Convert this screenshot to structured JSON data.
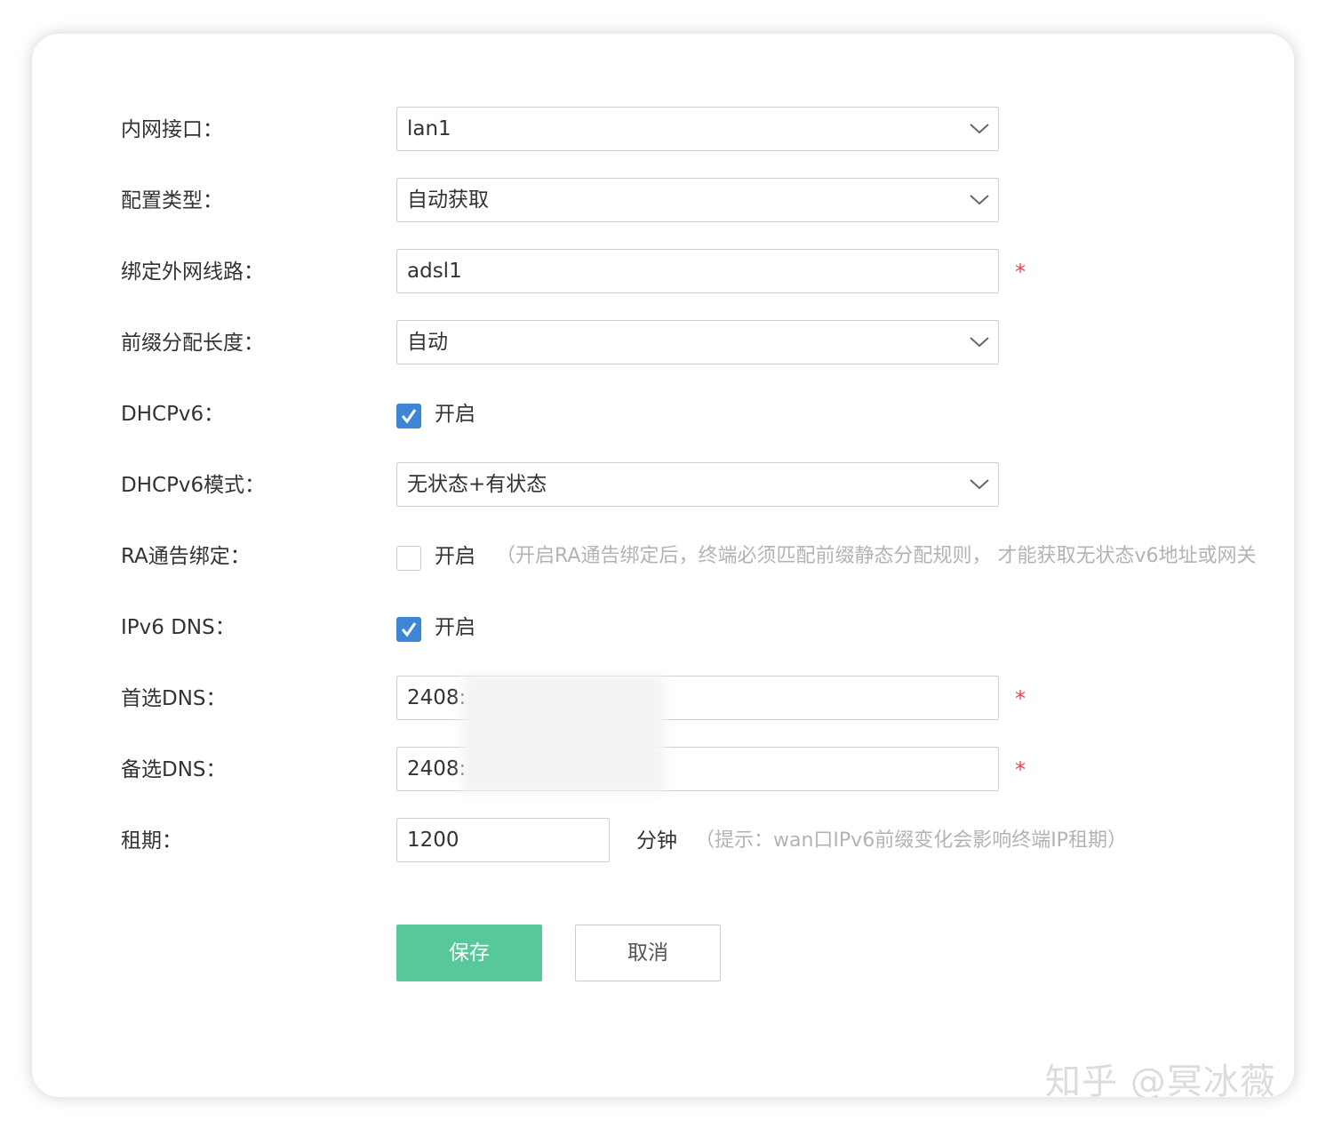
{
  "form": {
    "lan_interface": {
      "label": "内网接口：",
      "value": "lan1"
    },
    "config_type": {
      "label": "配置类型：",
      "value": "自动获取"
    },
    "bind_wan": {
      "label": "绑定外网线路：",
      "value": "adsl1",
      "required_mark": "*"
    },
    "prefix_length": {
      "label": "前缀分配长度：",
      "value": "自动"
    },
    "dhcpv6": {
      "label": "DHCPv6：",
      "checked": true,
      "option_text": "开启"
    },
    "dhcpv6_mode": {
      "label": "DHCPv6模式：",
      "value": "无状态+有状态"
    },
    "ra_binding": {
      "label": "RA通告绑定：",
      "checked": false,
      "option_text": "开启",
      "hint": "（开启RA通告绑定后，终端必须匹配前缀静态分配规则， 才能获取无状态v6地址或网关"
    },
    "ipv6_dns": {
      "label": "IPv6 DNS：",
      "checked": true,
      "option_text": "开启"
    },
    "primary_dns": {
      "label": "首选DNS：",
      "value": "2408:",
      "required_mark": "*"
    },
    "secondary_dns": {
      "label": "备选DNS：",
      "value": "2408:",
      "required_mark": "*"
    },
    "lease": {
      "label": "租期：",
      "value": "1200",
      "unit": "分钟",
      "hint": "（提示：wan口IPv6前缀变化会影响终端IP租期）"
    }
  },
  "buttons": {
    "save": "保存",
    "cancel": "取消"
  },
  "watermark": "知乎 @冥冰薇",
  "colors": {
    "save_button": "#58c79a",
    "checkbox_checked": "#3d86d6",
    "required": "#e04c4c"
  },
  "icons": {
    "dropdown": "chevron-down-icon",
    "check": "checkmark-icon"
  }
}
